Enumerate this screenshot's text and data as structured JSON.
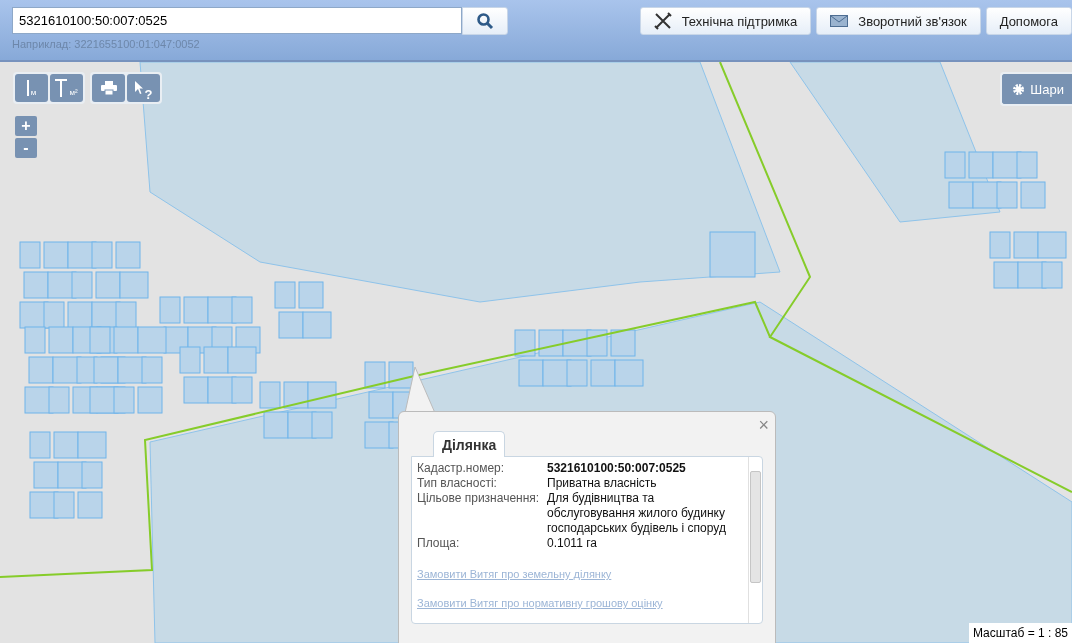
{
  "search": {
    "value": "5321610100:50:007:0525",
    "hint": "Наприклад: 3221655100:01:047:0052"
  },
  "header_buttons": [
    {
      "kind": "tools",
      "label": "Технічна підтримка"
    },
    {
      "kind": "mail",
      "label": "Зворотний зв'язок"
    },
    {
      "kind": "plain",
      "label": "Допомога"
    }
  ],
  "map_tools": [
    {
      "kind": "line",
      "label": "м"
    },
    {
      "kind": "area",
      "label": "м²"
    },
    {
      "kind": "print"
    },
    {
      "kind": "pointer",
      "label": "?"
    }
  ],
  "zoom": [
    "+",
    "-"
  ],
  "layers_button": "Шари",
  "popup": {
    "close": "×",
    "tabs": [
      {
        "label": "Ділянка",
        "selected": true
      }
    ],
    "fields": [
      {
        "label": "Кадастр.номер:",
        "value": "5321610100:50:007:0525",
        "bold": true
      },
      {
        "label": "Тип власності:",
        "value": "Приватна власність",
        "bold": false
      },
      {
        "label": "Цільове призначення:",
        "value": "Для будівництва та обслуговування жилого будинку господарських будівель і споруд",
        "bold": false
      },
      {
        "label": "Площа:",
        "value": "0.1011 га",
        "bold": false
      }
    ],
    "links": [
      "Замовити Витяг про земельну ділянку",
      "Замовити Витяг про нормативну грошову оцінку"
    ]
  },
  "scale": "Масштаб = 1 : 85"
}
